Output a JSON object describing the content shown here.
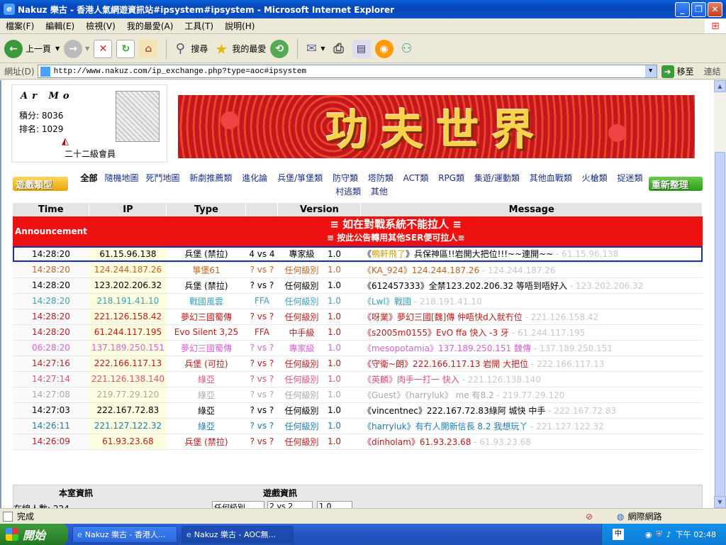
{
  "window": {
    "title": "Nakuz 樂古 - 香港人氣網遊資訊站#ipsystem#ipsystem - Microsoft Internet Explorer"
  },
  "menu": [
    "檔案(F)",
    "編輯(E)",
    "檢視(V)",
    "我的最愛(A)",
    "工具(T)",
    "說明(H)"
  ],
  "toolbar": {
    "back": "上一頁",
    "search": "搜尋",
    "favorites": "我的最愛"
  },
  "address": {
    "label": "網址(D)",
    "url": "http://www.nakuz.com/ip_exchange.php?type=aoc#ipsystem",
    "go": "移至",
    "links": "連結"
  },
  "user": {
    "name": "Ar Mo",
    "points": "積分: 8036",
    "rank": "排名: 1029",
    "level": "二十二級會員"
  },
  "banner": {
    "text": "功夫世界"
  },
  "categories": {
    "game_type_label": "遊戲類型",
    "items": [
      "全部",
      "隨機地圖",
      "死鬥地圖",
      "新劇推薦類",
      "進化論",
      "兵堡/箏堡類",
      "防守類",
      "塔防類",
      "ACT類",
      "RPG類",
      "集遊/運動類",
      "其他血戰類",
      "火槍類",
      "捉迷類",
      "村逃類",
      "其他"
    ],
    "refresh_label": "重新整理"
  },
  "table": {
    "headers": [
      "Time",
      "IP",
      "Type",
      "Version",
      "Message"
    ],
    "announcement": {
      "label": "Announcement",
      "line1": "≡ 如在對戰系統不能拉人 ≡",
      "line2": "≡ 按此公告轉用其他SER便可拉人≡"
    },
    "rows": [
      {
        "time": "14:28:20",
        "ip": "61.15.96.138",
        "type": "兵堡 (禁拉)",
        "vs": "4 vs 4",
        "level": "專家級",
        "ver": "1.0",
        "user": "鴨軒飛了",
        "msg": "兵保神區!!岩開大把位!!!~~連開~~",
        "ipc": "61.15.96.138",
        "color": "#000000",
        "selected": true
      },
      {
        "time": "14:28:20",
        "ip": "124.244.187.26",
        "type": "箏堡61",
        "vs": "? vs ?",
        "level": "任何級別",
        "ver": "1.0",
        "user": "KA_924",
        "msg": "124.244.187.26",
        "ipc": "124.244.187.26",
        "color": "#c8621a"
      },
      {
        "time": "14:28:20",
        "ip": "123.202.206.32",
        "type": "兵堡 (禁拉)",
        "vs": "? vs ?",
        "level": "任何級別",
        "ver": "1.0",
        "user": "612457333",
        "msg": "全禁123.202.206.32 等唔到唔好入",
        "ipc": "123.202.206.32",
        "color": "#000000"
      },
      {
        "time": "14:28:20",
        "ip": "218.191.41.10",
        "type": "戰國風雲",
        "vs": "FFA",
        "level": "任何級別",
        "ver": "1.0",
        "user": "Lwl",
        "msg": "戰國",
        "ipc": "218.191.41.10",
        "color": "#3aa0b8"
      },
      {
        "time": "14:28:20",
        "ip": "221.126.158.42",
        "type": "夢幻三國蜀傳",
        "vs": "? vs ?",
        "level": "任何級別",
        "ver": "1.0",
        "user": "呀業",
        "msg": "夢幻三國[魏]傳 仲唔快d入就冇位",
        "ipc": "221.126.158.42",
        "color": "#c81818"
      },
      {
        "time": "14:28:20",
        "ip": "61.244.117.195",
        "type": "Evo Silent 3,25",
        "vs": "FFA",
        "level": "中手級",
        "ver": "1.0",
        "user": "s2005m0155",
        "msg": "EvO ffa 快入 -3 牙",
        "ipc": "61.244.117.195",
        "color": "#c81818"
      },
      {
        "time": "06:28:20",
        "ip": "137.189.250.151",
        "type": "夢幻三國蜀傳",
        "vs": "? vs ?",
        "level": "專家級",
        "ver": "1.0",
        "user": "mesopotamia",
        "msg": "137.189.250.151 魏傳",
        "ipc": "137.189.250.151",
        "color": "#d860d8"
      },
      {
        "time": "14:27:16",
        "ip": "222.166.117.13",
        "type": "兵堡 (可拉)",
        "vs": "? vs ?",
        "level": "任何級別",
        "ver": "1.0",
        "user": "守衛~朗",
        "msg": "222.166.117.13 岩開 大把位",
        "ipc": "222.166.117.13",
        "color": "#c81818"
      },
      {
        "time": "14:27:14",
        "ip": "221.126.138.140",
        "type": "綠亞",
        "vs": "? vs ?",
        "level": "任何級別",
        "ver": "1.0",
        "user": "英麟",
        "msg": "肉手一打一 快入",
        "ipc": "221.126.138.140",
        "color": "#e0507a"
      },
      {
        "time": "14:27:08",
        "ip": "219.77.29.120",
        "type": "綠亞",
        "vs": "? vs ?",
        "level": "任何級別",
        "ver": "1.0",
        "user": "Guest",
        "msg": "《harryluk》 me 有8.2",
        "ipc": "219.77.29.120",
        "color": "#a8a8a8"
      },
      {
        "time": "14:27:03",
        "ip": "222.167.72.83",
        "type": "綠亞",
        "vs": "? vs ?",
        "level": "任何級別",
        "ver": "1.0",
        "user": "vincentnec",
        "msg": "222.167.72.83綠阿 城快 中手",
        "ipc": "222.167.72.83",
        "color": "#000000"
      },
      {
        "time": "14:26:11",
        "ip": "221.127.122.32",
        "type": "綠亞",
        "vs": "? vs ?",
        "level": "任何級別",
        "ver": "1.0",
        "user": "harryluk",
        "msg": "有冇人開新信長 8.2 我想玩丫",
        "ipc": "221.127.122.32",
        "color": "#1a7ab8"
      },
      {
        "time": "14:26:09",
        "ip": "61.93.23.68",
        "type": "兵堡 (禁拉)",
        "vs": "? vs ?",
        "level": "任何級別",
        "ver": "1.0",
        "user": "dinholam",
        "msg": "61.93.23.68",
        "ipc": "61.93.23.68",
        "color": "#c81818"
      }
    ]
  },
  "bottom": {
    "room_info": "本室資訊",
    "game_info": "遊戲資訊",
    "online": "在線人數: 224",
    "level_select": "任何級別",
    "vs_select": "2 vs 2",
    "ver_select": "1.0"
  },
  "status": {
    "text": "完成",
    "zone": "網際網路"
  },
  "taskbar": {
    "start": "開始",
    "tasks": [
      "Nakuz 樂古 - 香港人...",
      "Nakuz 樂古 - AOC無..."
    ],
    "clock": "下午 02:48"
  }
}
